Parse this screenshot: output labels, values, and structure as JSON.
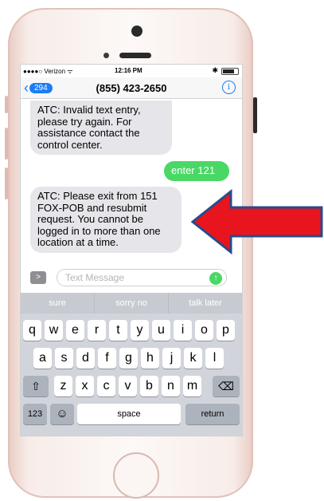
{
  "status_bar": {
    "carrier": "●●●●○ Verizon ᯤ",
    "time": "12:16 PM",
    "bluetooth": "✱"
  },
  "nav": {
    "back_count": "294",
    "title": "(855) 423-2650",
    "info": "i"
  },
  "messages": [
    {
      "direction": "in",
      "text": "ATC: Invalid text entry, please try again. For assistance contact the control center."
    },
    {
      "direction": "out",
      "text": "enter 121"
    },
    {
      "direction": "in",
      "text": "ATC: Please exit from 151 FOX-POB and resubmit request. You cannot be logged in to more than one location at a time."
    }
  ],
  "composer": {
    "placeholder": "Text Message",
    "value": ""
  },
  "predictions": [
    "sure",
    "sorry no",
    "talk later"
  ],
  "keyboard": {
    "row1": [
      "q",
      "w",
      "e",
      "r",
      "t",
      "y",
      "u",
      "i",
      "o",
      "p"
    ],
    "row2": [
      "a",
      "s",
      "d",
      "f",
      "g",
      "h",
      "j",
      "k",
      "l"
    ],
    "row3": [
      "z",
      "x",
      "c",
      "v",
      "b",
      "n",
      "m"
    ],
    "shift": "⇧",
    "delete": "⌫",
    "numbers": "123",
    "emoji": "☺",
    "space": "space",
    "return": "return"
  },
  "colors": {
    "accent": "#1b7df6",
    "outgoing_bubble": "#4ad865",
    "incoming_bubble": "#e5e5ea",
    "annotation_arrow_fill": "#e8141e",
    "annotation_arrow_stroke": "#2a4a8a"
  }
}
